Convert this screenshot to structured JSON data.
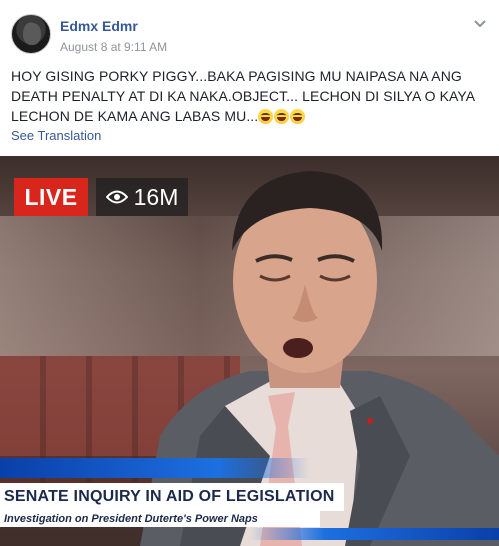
{
  "post": {
    "author": "Edmx Edmr",
    "timestamp": "August 8 at 9:11 AM",
    "text": "HOY GISING PORKY PIGGY...BAKA PAGISING MU NAIPASA NA ANG DEATH PENALTY AT DI KA NAKA.OBJECT... LECHON DI SILYA O KAYA LECHON DE KAMA ANG LABAS MU...",
    "emojis": [
      "grinning-squinting-face",
      "grinning-squinting-face",
      "grinning-squinting-face"
    ],
    "see_translation": "See Translation",
    "more_icon": "chevron-down-icon"
  },
  "photo": {
    "live_label": "LIVE",
    "viewers_icon": "eye-icon",
    "viewers_count": "16M",
    "headline": "SENATE INQUIRY IN AID OF LEGISLATION",
    "subheadline": "Investigation on President Duterte's Power Naps"
  },
  "colors": {
    "link": "#365899",
    "meta": "#90949c",
    "live_red": "#d9261c",
    "news_blue": "#1d6fe0"
  }
}
